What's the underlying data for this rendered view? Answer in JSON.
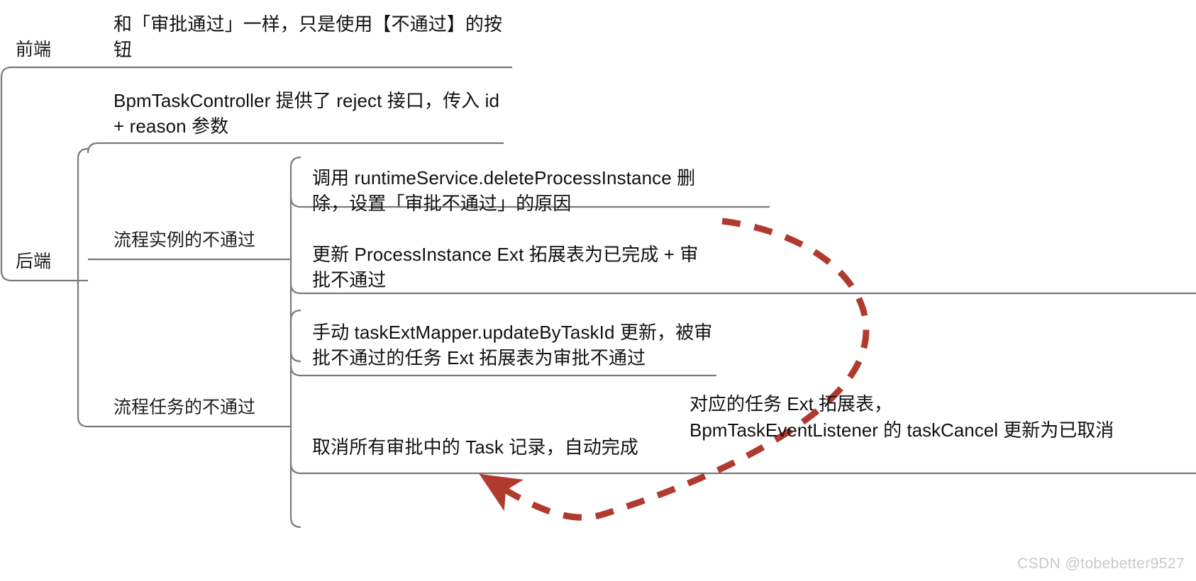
{
  "diagram": {
    "type": "mind-map",
    "background": "#ffffff",
    "line_color": "#7a7a7a",
    "text_color": "#111111",
    "arrow_color": "#b03a2e",
    "watermark": "CSDN @tobebetter9527"
  },
  "nodes": {
    "frontend_label": "前端",
    "backend_label": "后端",
    "frontend_detail": "和「审批通过」一样，只是使用【不通过】的按钮",
    "backend_api": "BpmTaskController 提供了 reject 接口，传入 id + reason 参数",
    "process_instance_label": "流程实例的不通过",
    "process_task_label": "流程任务的不通过",
    "pi_leaf_1": "调用 runtimeService.deleteProcessInstance 删除，设置「审批不通过」的原因",
    "pi_leaf_2": "更新 ProcessInstance Ext 拓展表为已完成 + 审批不通过",
    "pt_leaf_1": "手动 taskExtMapper.updateByTaskId 更新，被审批不通过的任务 Ext 拓展表为审批不通过",
    "pt_leaf_2": "取消所有审批中的 Task 记录，自动完成",
    "annotation": "对应的任务 Ext 拓展表，\nBpmTaskEventListener 的 taskCancel 更新为已取消"
  }
}
